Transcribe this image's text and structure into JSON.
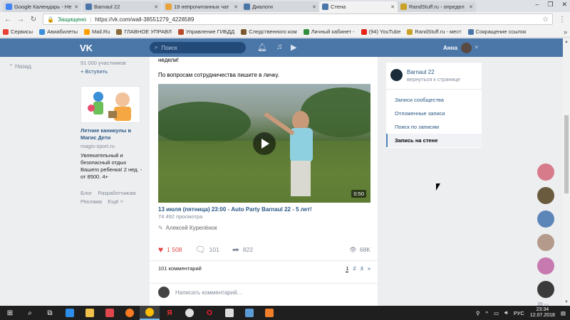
{
  "browser": {
    "tabs": [
      {
        "title": "Google Календарь - Не",
        "color": "#4285f4",
        "active": false
      },
      {
        "title": "Barnaul 22",
        "color": "#4a76a8",
        "active": false
      },
      {
        "title": "19 непрочитанных чат",
        "color": "#e8a33d",
        "active": false
      },
      {
        "title": "Диалоги",
        "color": "#4a76a8",
        "active": false
      },
      {
        "title": "Стена",
        "color": "#4a76a8",
        "active": true
      },
      {
        "title": "RandStuff.ru - определ",
        "color": "#c9a227",
        "active": false
      }
    ],
    "security_label": "Защищено",
    "url": "https://vk.com/wall-38551279_4228589",
    "bookmarks": [
      {
        "label": "Сервисы",
        "color": "#e94235"
      },
      {
        "label": "Авиабилеты",
        "color": "#3b8fd8"
      },
      {
        "label": "Mail.Ru",
        "color": "#ff9e00"
      },
      {
        "label": "ГЛАВНОЕ УПРАВЛ",
        "color": "#8a6b3a"
      },
      {
        "label": "Управление ГИБДД",
        "color": "#b74b2b"
      },
      {
        "label": "Следственного ком",
        "color": "#7a5a2e"
      },
      {
        "label": "Личный кабинет - ",
        "color": "#2f8f3a"
      },
      {
        "label": "(94) YouTube",
        "color": "#e62117"
      },
      {
        "label": "RandStuff.ru - мест",
        "color": "#c9a227"
      },
      {
        "label": "Сокращение ссылок",
        "color": "#4a76a8"
      }
    ]
  },
  "vk": {
    "logo": "VK",
    "search_placeholder": "Поиск",
    "user_name": "Анна",
    "back_label": "Назад",
    "group_members": "91 000 участников",
    "join_label": "+ Вступить",
    "ad": {
      "title": "Летние каникулы в Магис Дети",
      "domain": "magis-sport.ru",
      "text": "Увлекательный и безопасный отдых Вашего ребенка! 2 нед. - от 8500. 4+"
    },
    "footer_links": [
      "Блог",
      "Разработчикам",
      "Реклама",
      "Ещё ˅"
    ],
    "post": {
      "text_line1": "недели!",
      "text_line2": "По вопросам сотрудничества пишите в личку.",
      "video_duration": "0:50",
      "video_title": "13 июля (пятница) 23:00 - Auto Party Barnaul 22 - 5 лет!",
      "video_views": "74 492 просмотра",
      "author": "Алексей Курелёнок",
      "likes": "1 508",
      "comments": "101",
      "shares": "822",
      "views": "68K",
      "comment_count_label": "101 комментарий",
      "pages": [
        "1",
        "2",
        "3",
        "»"
      ],
      "comment_placeholder": "Написать комментарий..."
    },
    "right_nav": {
      "group_name": "Barnaul 22",
      "group_sub": "вернуться к странице",
      "items": [
        "Записи сообщества",
        "Отложенные записи",
        "Поиск по записям",
        "Запись на стене"
      ]
    },
    "chat_count": "39"
  },
  "taskbar": {
    "language": "РУС",
    "time": "23:34",
    "date": "12.07.2018"
  }
}
